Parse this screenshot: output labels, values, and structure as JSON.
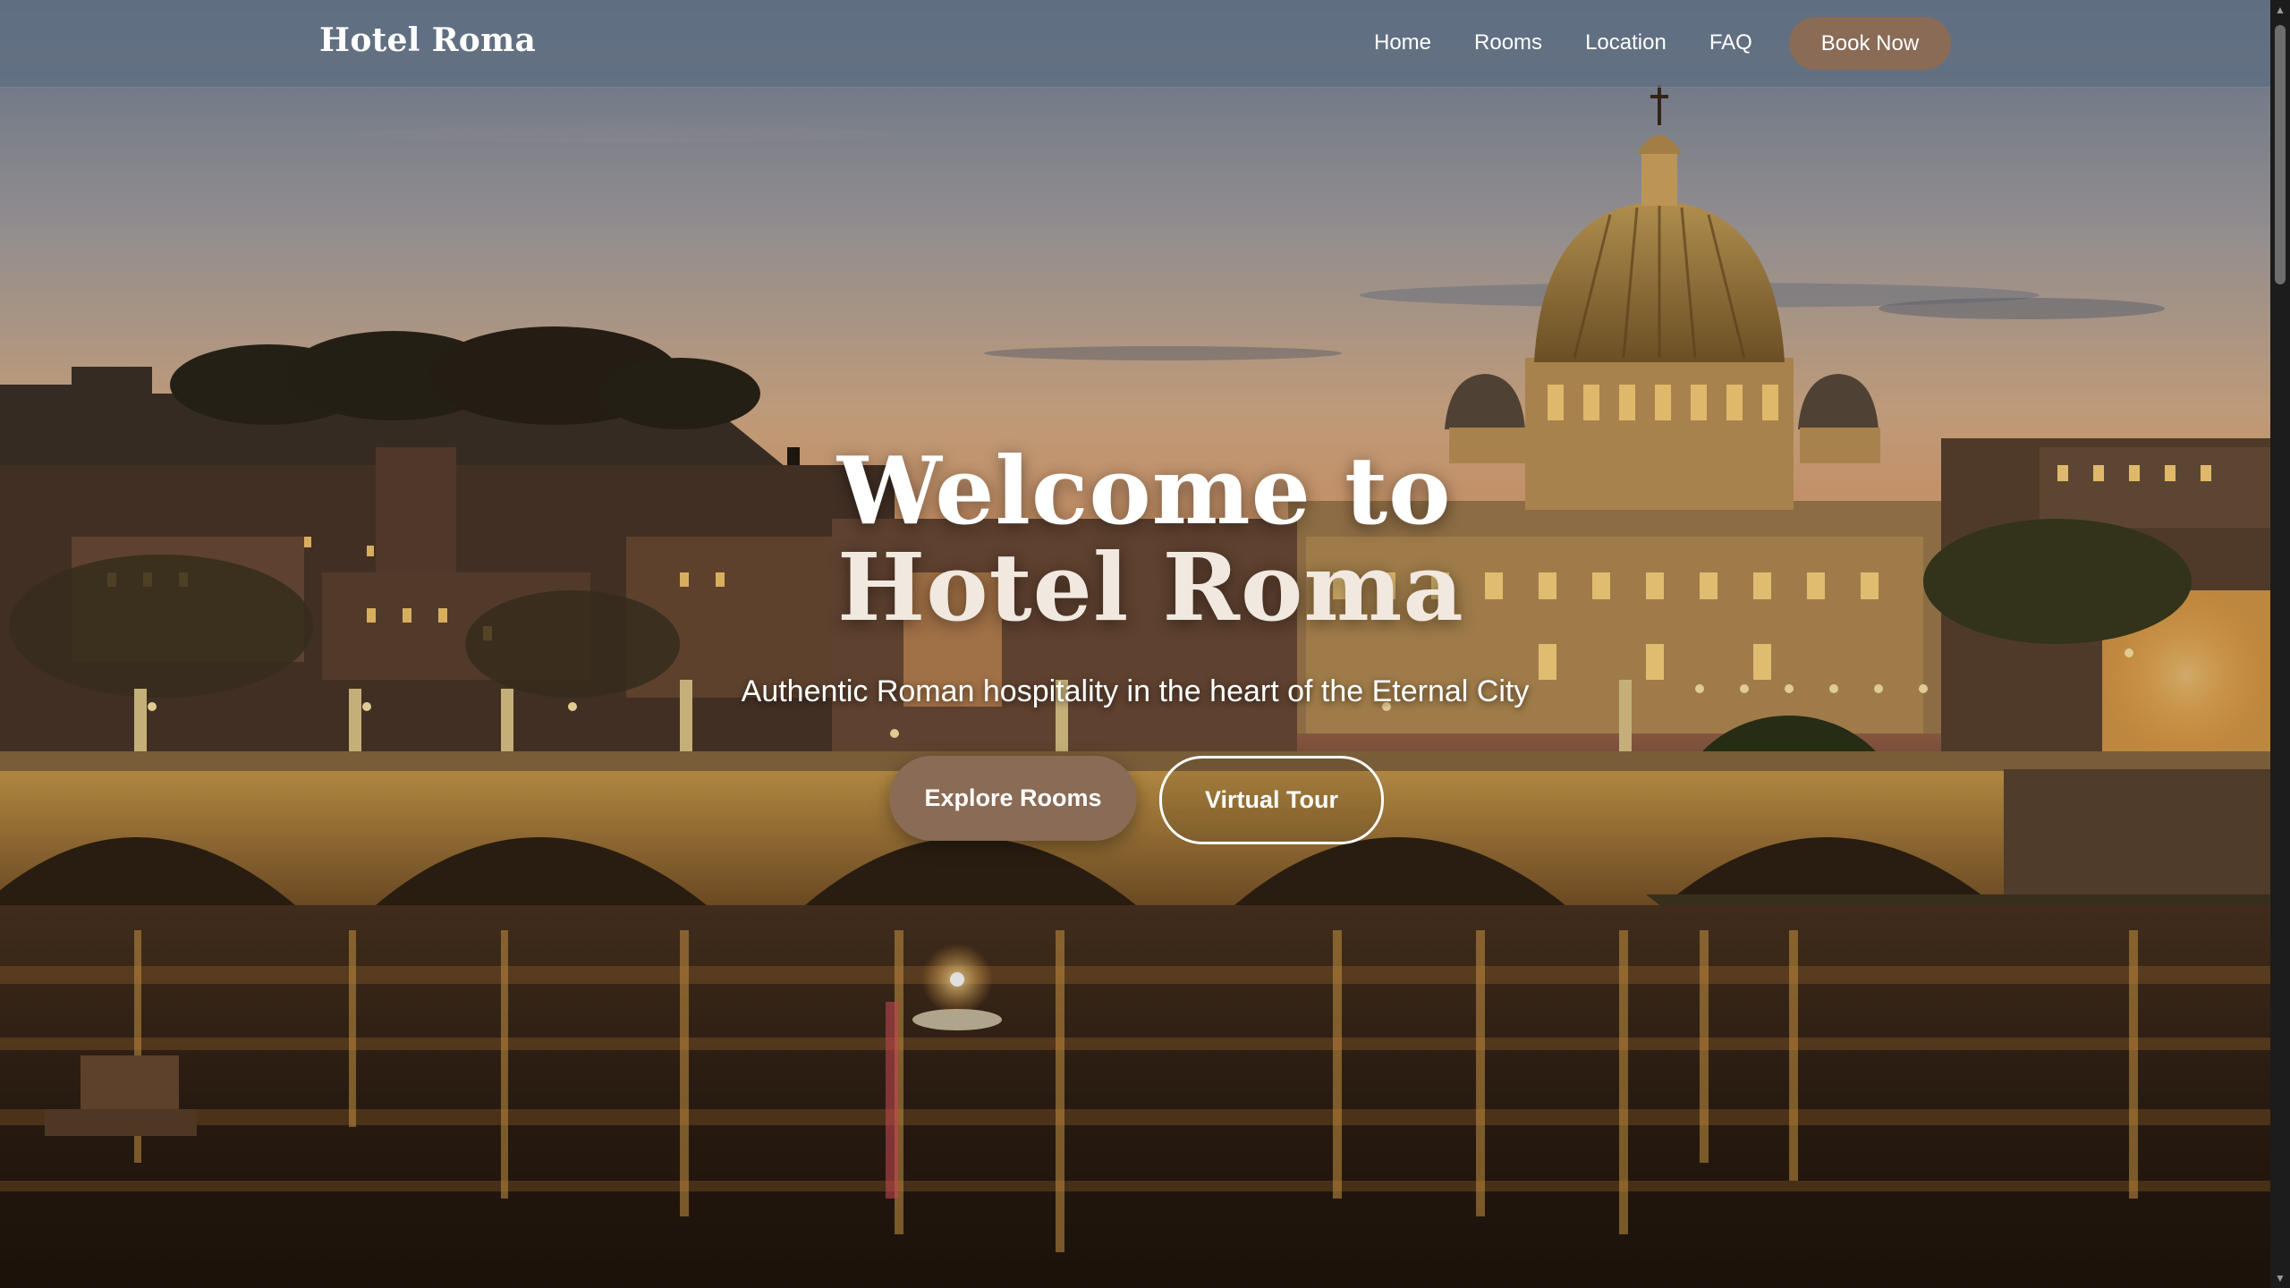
{
  "nav": {
    "brand": "Hotel Roma",
    "links": [
      "Home",
      "Rooms",
      "Location",
      "FAQ"
    ],
    "cta": "Book Now"
  },
  "hero": {
    "title_line1": "Welcome to",
    "title_line2": "Hotel Roma",
    "subtitle": "Authentic Roman hospitality in the heart of the Eternal City",
    "primary_button": "Explore Rooms",
    "secondary_button": "Virtual Tour",
    "background": "Rome skyline at dusk with St. Peter's Basilica dome and illuminated bridge over the Tiber river"
  },
  "colors": {
    "accent": "#8a6b55",
    "nav_bg": "#5f6e82",
    "text": "#ffffff"
  }
}
